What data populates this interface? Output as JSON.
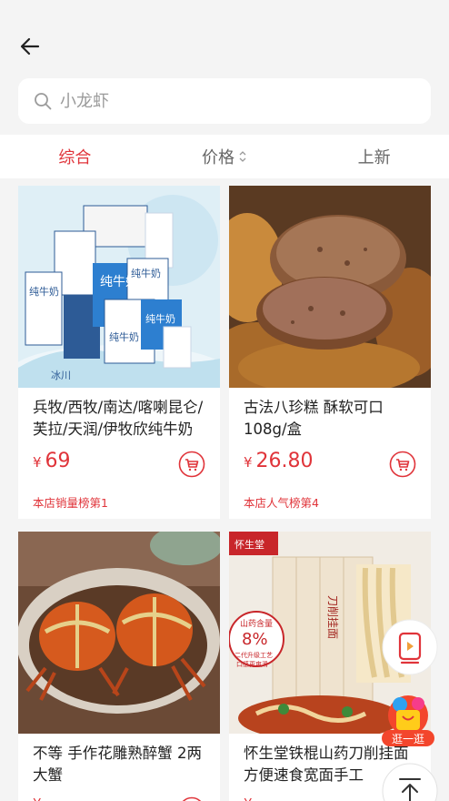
{
  "search": {
    "placeholder": "小龙虾"
  },
  "tabs": [
    {
      "label": "综合",
      "active": true
    },
    {
      "label": "价格",
      "sortable": true
    },
    {
      "label": "上新"
    }
  ],
  "products": [
    {
      "title": "兵牧/西牧/南达/喀喇昆仑/芙拉/天润/伊牧欣纯牛奶",
      "currency": "¥",
      "price": "69",
      "rank_label": "本店销量榜第1",
      "image_labels": [
        "纯牛奶",
        "纯牛奶",
        "纯牛奶",
        "纯牛奶",
        "纯牛奶",
        "冰川"
      ]
    },
    {
      "title": "古法八珍糕 酥软可口 108g/盒",
      "currency": "¥",
      "price": "26.80",
      "rank_label": "本店人气榜第4"
    },
    {
      "title": "不等 手作花雕熟醉蟹 2两大蟹",
      "currency": "¥",
      "price": "",
      "rank_label": ""
    },
    {
      "title": "怀生堂铁棍山药刀削挂面 方便速食宽面手工",
      "currency": "¥",
      "price": "",
      "rank_label": "",
      "image_labels": [
        "怀生堂",
        "山药含量",
        "8%",
        "二代升级工艺",
        "口感更爽滑",
        "刀削挂面"
      ]
    }
  ],
  "floating": {
    "shop_badge": "逛一逛"
  },
  "colors": {
    "accent": "#e0343a",
    "background": "#f4f4f4"
  },
  "icons": [
    "back-arrow-icon",
    "search-icon",
    "sort-updown-icon",
    "cart-icon",
    "video-icon",
    "shopping-bag-icon",
    "scroll-top-icon"
  ]
}
